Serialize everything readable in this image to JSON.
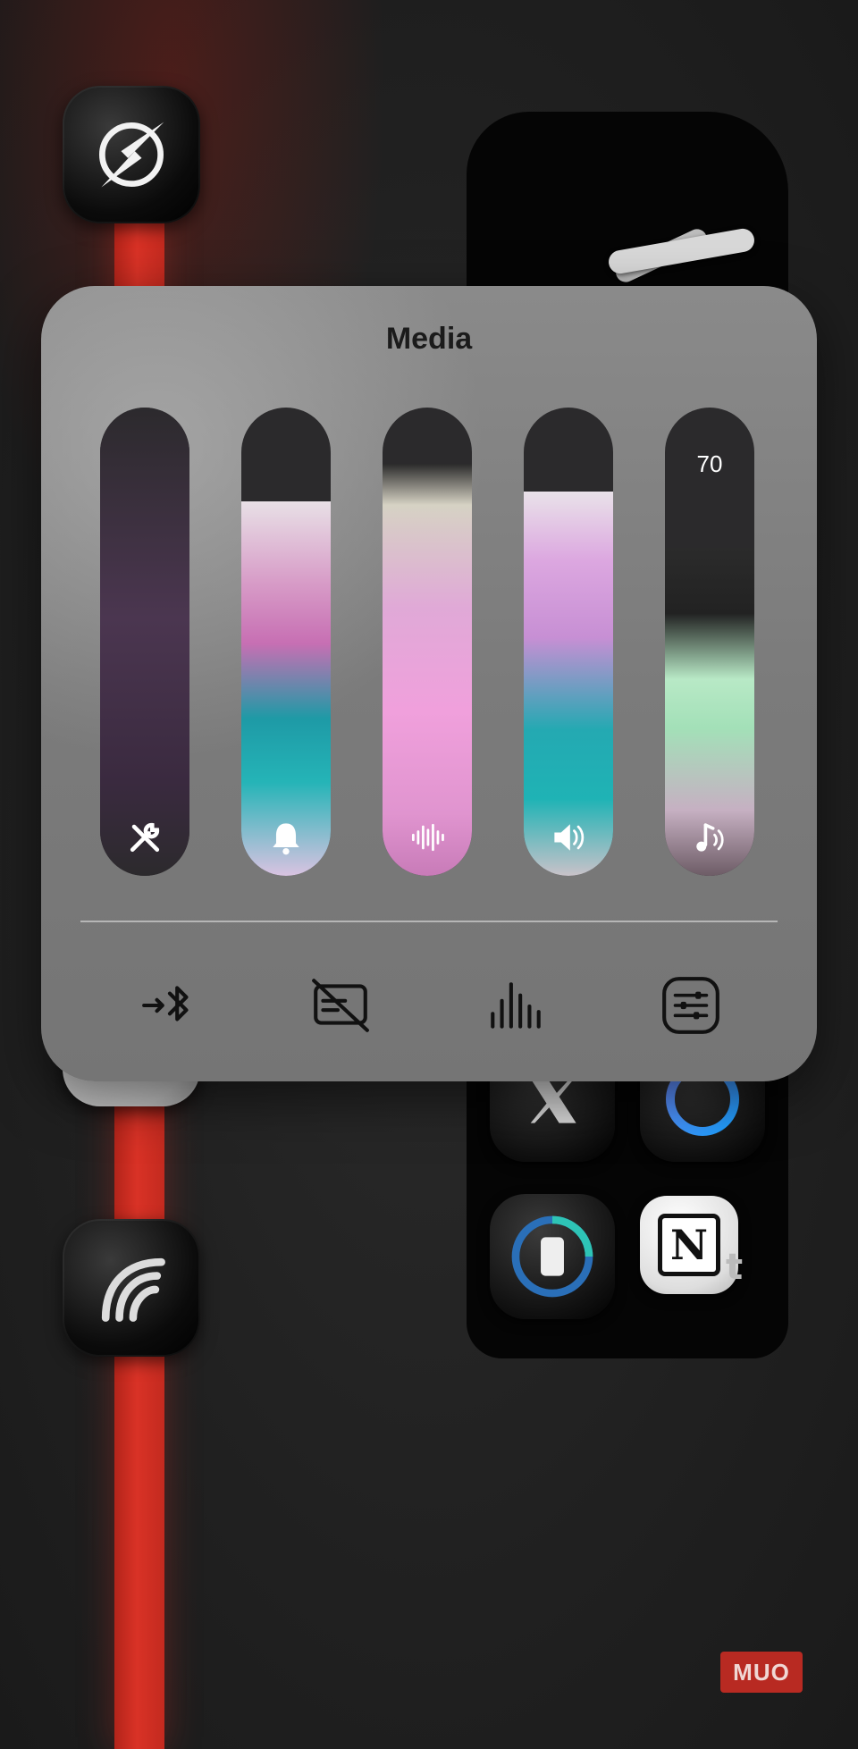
{
  "panel": {
    "title": "Media"
  },
  "sliders": [
    {
      "name": "accessibility",
      "icon": "accessibility-tools-icon",
      "level": 0.0,
      "fill": "#3b2940"
    },
    {
      "name": "ringer",
      "icon": "bell-icon",
      "level": 0.8,
      "fill": "linear"
    },
    {
      "name": "voice",
      "icon": "audio-waveform-icon",
      "level": 1.0,
      "fill": "linear"
    },
    {
      "name": "speaker",
      "icon": "speaker-volume-icon",
      "level": 0.8,
      "fill": "linear"
    },
    {
      "name": "media",
      "icon": "music-note-icon",
      "level": 0.7,
      "value_label": "70"
    }
  ],
  "bottom_buttons": [
    {
      "icon": "bluetooth-connect-icon"
    },
    {
      "icon": "captions-off-icon"
    },
    {
      "icon": "equalizer-icon"
    },
    {
      "icon": "sliders-settings-icon"
    }
  ],
  "watermark": {
    "text": "MUO"
  },
  "partial_label": "t",
  "colors": {
    "red_strip": "#d93226",
    "panel_bg": "#7b7b7b",
    "slider_track": "#2b2a2c"
  }
}
